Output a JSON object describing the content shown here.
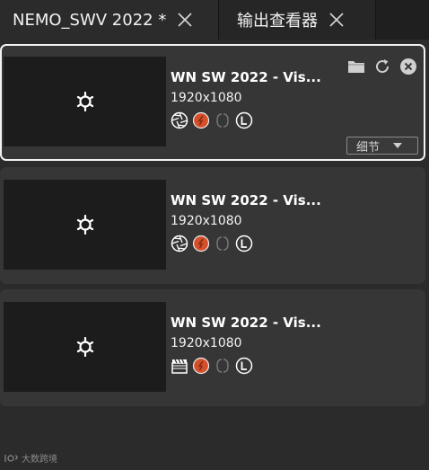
{
  "tabs": [
    {
      "label": "NEMO_SWV 2022 *",
      "active": true
    },
    {
      "label": "输出查看器",
      "active": false
    }
  ],
  "cards": [
    {
      "title": "WN SW 2022 - Vis...",
      "resolution": "1920x1080",
      "first_icon": "aperture-icon",
      "selected": true
    },
    {
      "title": "WN SW 2022 - Vis...",
      "resolution": "1920x1080",
      "first_icon": "aperture-icon",
      "selected": false
    },
    {
      "title": "WN SW 2022 - Vis...",
      "resolution": "1920x1080",
      "first_icon": "clapperboard-icon",
      "selected": false
    }
  ],
  "details_label": "细节",
  "watermark": "大数跨境",
  "colors": {
    "background": "#2b2b2b",
    "card": "#363636",
    "thumbnail": "#1c1c1c",
    "accent_red": "#d4502a",
    "selected_border": "#f2f2f2"
  }
}
